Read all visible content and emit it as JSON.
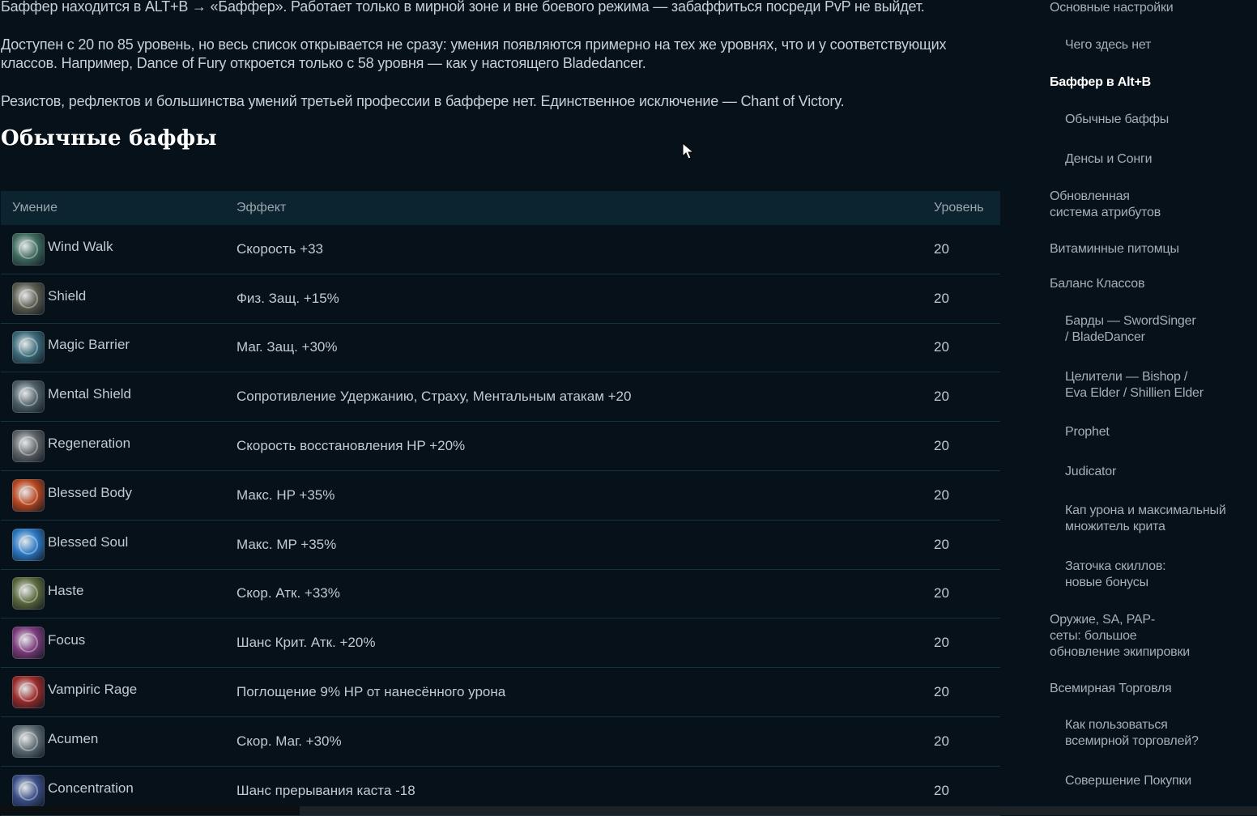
{
  "article": {
    "para1": "Баффер находится в ALT+B → «Баффер». Работает только в мирной зоне и вне боевого режима — забаффиться посреди PvP не выйдет.",
    "para2": "Доступен с 20 по 85 уровень, но весь список открывается не сразу: умения появляются примерно на тех же уровнях, что и у соответствующих классов. Например, Dance of Fury откроется только с 58 уровня — как у настоящего Bladedancer.",
    "para3": "Резистов, рефлектов и большинства умений третьей профессии в баффере нет. Единственное исключение — Chant of Victory.",
    "section_title": "Обычные баффы"
  },
  "table": {
    "headers": {
      "skill": "Умение",
      "effect": "Эффект",
      "level": "Уровень"
    },
    "rows": [
      {
        "icon": "wind-walk-icon",
        "color": "#3f6b5e",
        "name": "Wind Walk",
        "effect": "Скорость +33",
        "level": "20"
      },
      {
        "icon": "shield-icon",
        "color": "#5a5a4e",
        "name": "Shield",
        "effect": "Физ. Защ. +15%",
        "level": "20"
      },
      {
        "icon": "magic-barrier-icon",
        "color": "#3a6a78",
        "name": "Magic Barrier",
        "effect": "Маг. Защ. +30%",
        "level": "20"
      },
      {
        "icon": "mental-shield-icon",
        "color": "#4d5e66",
        "name": "Mental Shield",
        "effect": "Сопротивление Удержанию, Страху, Ментальным атакам +20",
        "level": "20"
      },
      {
        "icon": "regeneration-icon",
        "color": "#5d6266",
        "name": "Regeneration",
        "effect": "Скорость восстановления HP +20%",
        "level": "20"
      },
      {
        "icon": "blessed-body-icon",
        "color": "#b8461f",
        "name": "Blessed Body",
        "effect": "Макс. HP +35%",
        "level": "20"
      },
      {
        "icon": "blessed-soul-icon",
        "color": "#2b78c4",
        "name": "Blessed Soul",
        "effect": "Макс. MP +35%",
        "level": "20"
      },
      {
        "icon": "haste-icon",
        "color": "#5b6a3d",
        "name": "Haste",
        "effect": "Скор. Атк. +33%",
        "level": "20"
      },
      {
        "icon": "focus-icon",
        "color": "#7a3a7a",
        "name": "Focus",
        "effect": "Шанс Крит. Атк. +20%",
        "level": "20"
      },
      {
        "icon": "vampiric-rage-icon",
        "color": "#9a2a2a",
        "name": "Vampiric Rage",
        "effect": "Поглощение 9% HP от нанесённого урона",
        "level": "20"
      },
      {
        "icon": "acumen-icon",
        "color": "#5c6a72",
        "name": "Acumen",
        "effect": "Скор. Маг. +30%",
        "level": "20"
      },
      {
        "icon": "concentration-icon",
        "color": "#3a4e86",
        "name": "Concentration",
        "effect": "Шанс прерывания каста -18",
        "level": "20"
      }
    ]
  },
  "toc": {
    "items": [
      {
        "label": "Основные настройки",
        "level": "top",
        "active": false
      },
      {
        "label": "Чего здесь нет",
        "level": "sub",
        "active": false
      },
      {
        "label": "Баффер в Alt+B",
        "level": "top",
        "active": true
      },
      {
        "label": "Обычные баффы",
        "level": "sub",
        "active": false
      },
      {
        "label": "Денсы и Сонги",
        "level": "sub",
        "active": false
      },
      {
        "label": "Обновленная\nсистема атрибутов",
        "level": "top",
        "active": false
      },
      {
        "label": "Витаминные питомцы",
        "level": "top",
        "active": false
      },
      {
        "label": "Баланс Классов",
        "level": "top",
        "active": false
      },
      {
        "label": "Барды — SwordSinger\n/ BladeDancer",
        "level": "sub",
        "active": false
      },
      {
        "label": "Целители — Bishop /\nEva Elder / Shillien Elder",
        "level": "sub",
        "active": false
      },
      {
        "label": "Prophet",
        "level": "sub",
        "active": false
      },
      {
        "label": "Judicator",
        "level": "sub",
        "active": false
      },
      {
        "label": "Кап урона и максимальный\nмножитель крита",
        "level": "sub",
        "active": false
      },
      {
        "label": "Заточка скиллов:\nновые бонусы",
        "level": "sub",
        "active": false
      },
      {
        "label": "Оружие, SA, PAP-\nсеты: большое\nобновление экипировки",
        "level": "top",
        "active": false
      },
      {
        "label": "Всемирная Торговля",
        "level": "top",
        "active": false
      },
      {
        "label": "Как пользоваться\nвсемирной торговлей?",
        "level": "sub",
        "active": false
      },
      {
        "label": "Совершение Покупки",
        "level": "sub",
        "active": false
      }
    ]
  }
}
